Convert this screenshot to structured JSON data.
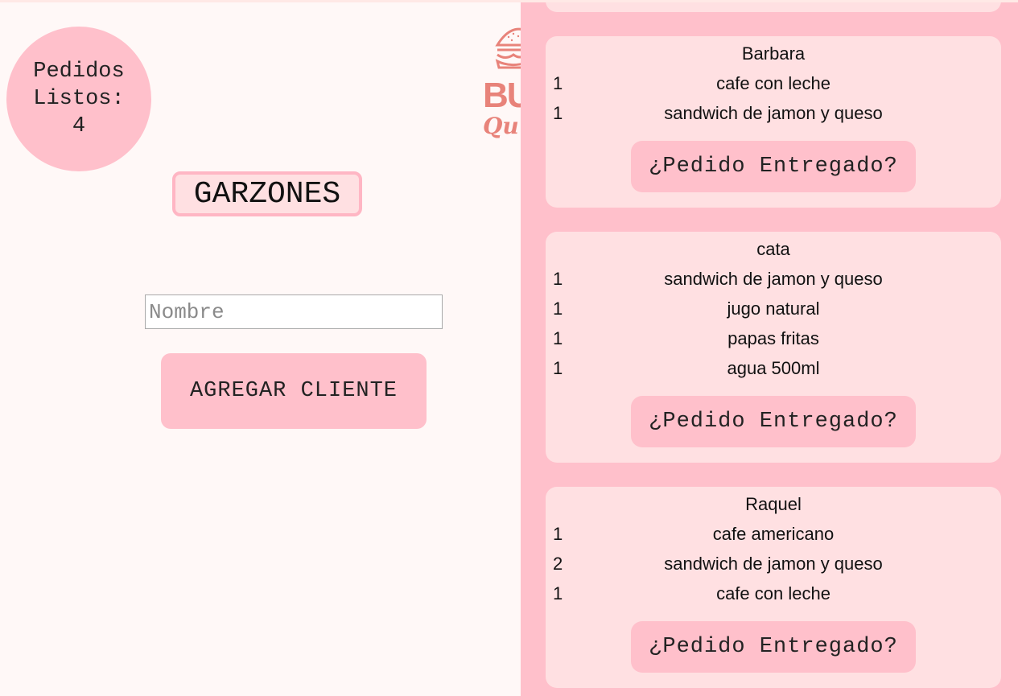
{
  "ready": {
    "label_line1": "Pedidos",
    "label_line2": "Listos:",
    "count": "4"
  },
  "logo": {
    "icon": "burger-logo-icon",
    "partial_text_top": "BUR",
    "partial_text_bottom": "Qu"
  },
  "title": "GARZONES",
  "client_form": {
    "name_placeholder": "Nombre",
    "name_value": "",
    "add_button_label": "AGREGAR CLIENTE"
  },
  "colors": {
    "accent": "#ffc0cb",
    "card": "#ffe0e2",
    "background": "#fff8f7",
    "logo": "#e8837a"
  },
  "orders": [
    {
      "client": "Barbara",
      "items": [
        {
          "qty": "1",
          "name": "cafe con leche"
        },
        {
          "qty": "1",
          "name": "sandwich de jamon y queso"
        }
      ],
      "action_label": "¿Pedido Entregado?"
    },
    {
      "client": "cata",
      "items": [
        {
          "qty": "1",
          "name": "sandwich de jamon y queso"
        },
        {
          "qty": "1",
          "name": "jugo natural"
        },
        {
          "qty": "1",
          "name": "papas fritas"
        },
        {
          "qty": "1",
          "name": "agua 500ml"
        }
      ],
      "action_label": "¿Pedido Entregado?"
    },
    {
      "client": "Raquel",
      "items": [
        {
          "qty": "1",
          "name": "cafe americano"
        },
        {
          "qty": "2",
          "name": "sandwich de jamon y queso"
        },
        {
          "qty": "1",
          "name": "cafe con leche"
        }
      ],
      "action_label": "¿Pedido Entregado?"
    }
  ]
}
